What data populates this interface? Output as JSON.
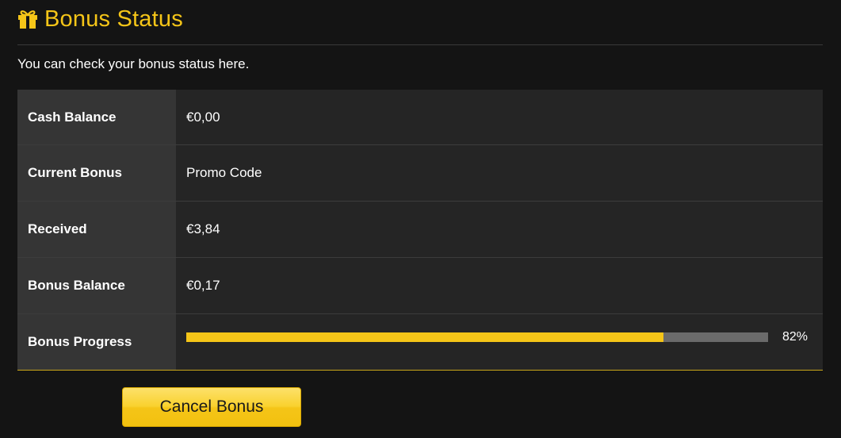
{
  "header": {
    "icon": "gift-icon",
    "title": "Bonus Status"
  },
  "intro_text": "You can check your bonus status here.",
  "rows": [
    {
      "label": "Cash Balance",
      "value": "€0,00"
    },
    {
      "label": "Current Bonus",
      "value": "Promo Code"
    },
    {
      "label": "Received",
      "value": "€3,84"
    },
    {
      "label": "Bonus Balance",
      "value": "€0,17"
    }
  ],
  "progress": {
    "label": "Bonus Progress",
    "percent": 82,
    "percent_text": "82%"
  },
  "actions": {
    "cancel_label": "Cancel Bonus"
  },
  "colors": {
    "accent": "#f5c518",
    "background": "#141414",
    "label_cell": "#353535",
    "value_cell": "#252525",
    "progress_track": "#6b6b6b"
  }
}
